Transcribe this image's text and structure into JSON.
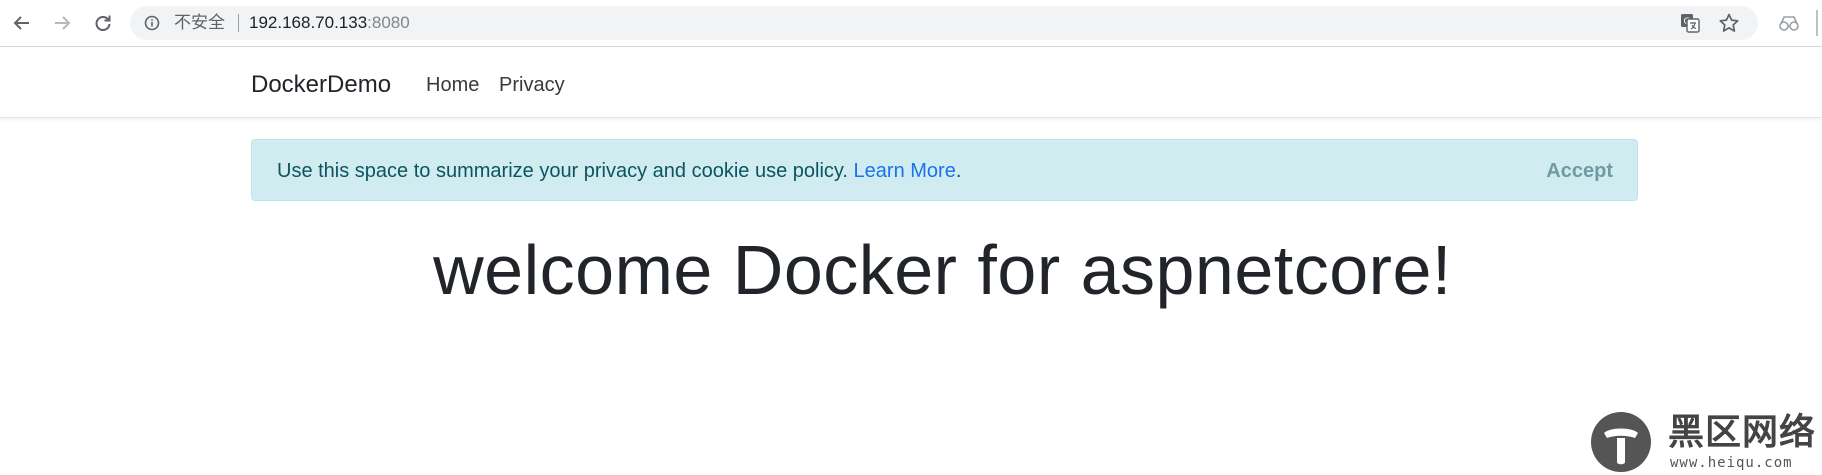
{
  "browser": {
    "security_label": "不安全",
    "url_host": "192.168.70.133",
    "url_port": ":8080",
    "icons": [
      "back-arrow-icon",
      "forward-arrow-icon",
      "reload-icon",
      "info-icon",
      "translate-icon",
      "star-icon",
      "profile-icon"
    ]
  },
  "navbar": {
    "brand": "DockerDemo",
    "links": [
      "Home",
      "Privacy"
    ]
  },
  "cookie_alert": {
    "message": "Use this space to summarize your privacy and cookie use policy. ",
    "link_text": "Learn More",
    "link_suffix": ".",
    "accept_label": "Accept"
  },
  "main": {
    "heading": "welcome Docker for aspnetcore!"
  },
  "watermark": {
    "name": "黑区网络",
    "url": "www.heiqu.com"
  },
  "colors": {
    "alert_bg": "#d1ecf1",
    "alert_text": "#0c5460",
    "link": "#1a73e8"
  }
}
